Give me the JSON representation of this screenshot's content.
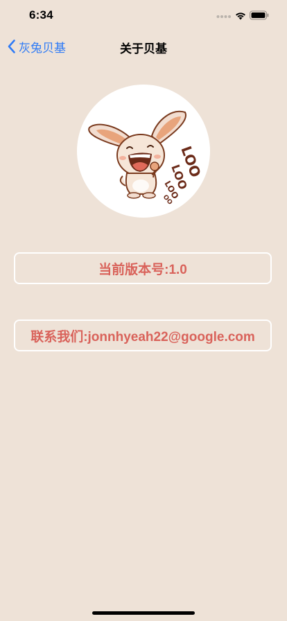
{
  "status_bar": {
    "time": "6:34"
  },
  "nav": {
    "back_label": "灰兔贝基",
    "title": "关于贝基"
  },
  "logo": {
    "icon": "bunny-mascot-icon"
  },
  "info": {
    "version_text": "当前版本号:1.0",
    "contact_text": "联系我们:jonnhyeah22@google.com"
  },
  "colors": {
    "background": "#EEE2D7",
    "accent_text": "#D9625A",
    "link_blue": "#2F7BF6",
    "box_border": "#FFFFFF"
  }
}
